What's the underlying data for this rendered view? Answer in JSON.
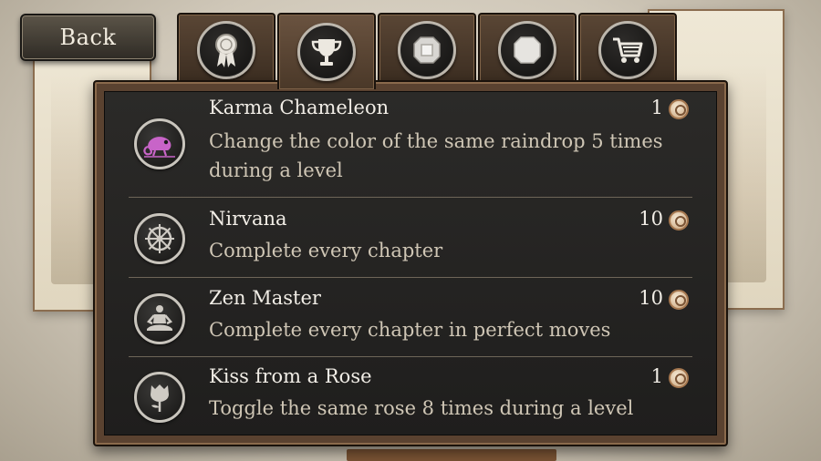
{
  "nav": {
    "back_label": "Back"
  },
  "tabs": [
    {
      "icon": "ribbon-icon",
      "active": false
    },
    {
      "icon": "trophy-icon",
      "active": true
    },
    {
      "icon": "gem-icon",
      "active": false
    },
    {
      "icon": "octagon-icon",
      "active": false
    },
    {
      "icon": "cart-icon",
      "active": false
    }
  ],
  "achievements": [
    {
      "title": "Karma Chameleon",
      "description": "Change the color of the same raindrop 5 times during a level",
      "points": "1",
      "icon": "chameleon-icon",
      "highlight_color": "#c864c8"
    },
    {
      "title": "Nirvana",
      "description": "Complete every chapter",
      "points": "10",
      "icon": "dharma-wheel-icon"
    },
    {
      "title": "Zen Master",
      "description": "Complete every chapter in perfect moves",
      "points": "10",
      "icon": "meditation-icon"
    },
    {
      "title": "Kiss from a Rose",
      "description": "Toggle the same rose 8 times during a level",
      "points": "1",
      "icon": "rose-icon"
    }
  ],
  "colors": {
    "panel_frame": "#5a4230",
    "panel_bg": "#2b2a28",
    "text": "#f1ede6",
    "desc_text": "#cfc6b5"
  }
}
